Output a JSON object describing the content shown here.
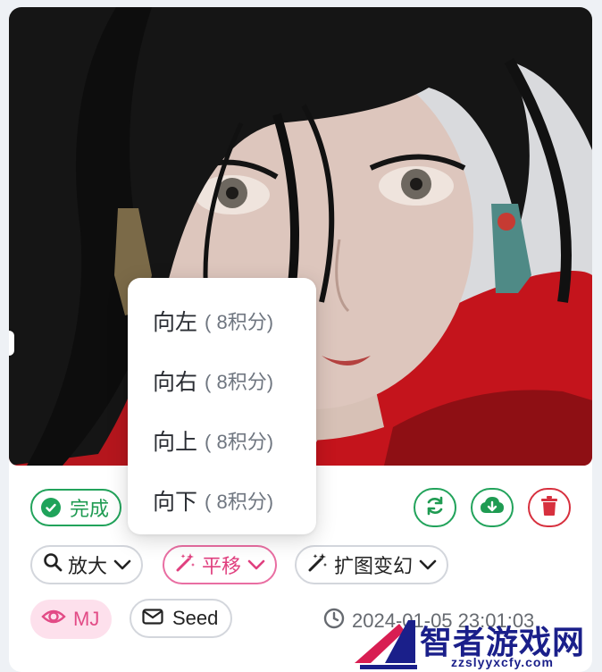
{
  "status": {
    "label": "完成"
  },
  "actions": {
    "refresh_icon": "refresh-icon",
    "download_icon": "cloud-download-icon",
    "delete_icon": "trash-icon"
  },
  "tools": [
    {
      "label": "放大",
      "icon": "search-icon"
    },
    {
      "label": "平移",
      "icon": "magic-wand-icon",
      "active": true
    },
    {
      "label": "扩图变幻",
      "icon": "magic-wand-icon"
    }
  ],
  "menu": {
    "items": [
      {
        "label": "向左",
        "cost": "( 8积分)"
      },
      {
        "label": "向右",
        "cost": "( 8积分)"
      },
      {
        "label": "向上",
        "cost": "( 8积分)"
      },
      {
        "label": "向下",
        "cost": "( 8积分)"
      }
    ]
  },
  "meta": {
    "model": "MJ",
    "seed_label": "Seed",
    "timestamp": "2024-01-05 23:01:03"
  },
  "watermark": {
    "name": "智者游戏网",
    "url": "zzslyyxcfy.com"
  },
  "colors": {
    "success": "#22a35b",
    "danger": "#d7303e",
    "accent_pink": "#e96ea2"
  }
}
